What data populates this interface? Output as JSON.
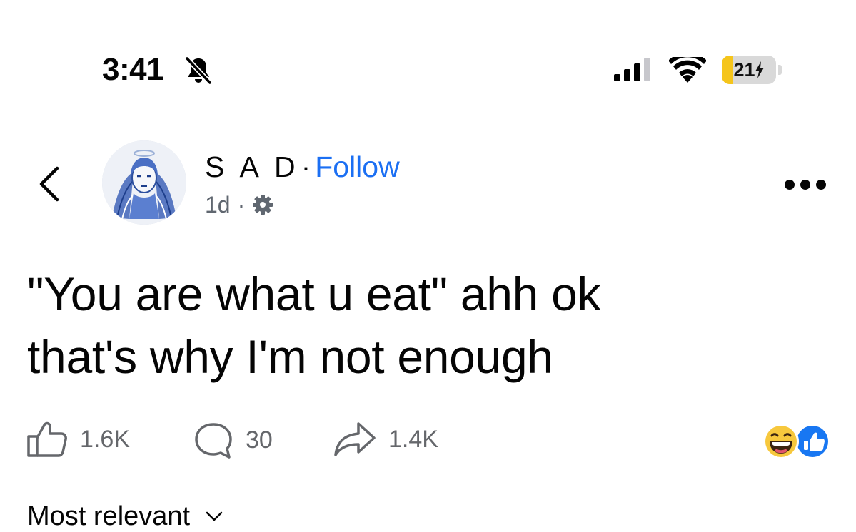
{
  "status_bar": {
    "time": "3:41",
    "icons": [
      "bell-slash-icon",
      "cellular-signal-icon",
      "wifi-icon",
      "battery-icon"
    ],
    "battery_percent": 21,
    "battery_label": "21",
    "battery_charging": true,
    "battery_color": "#f5c51b"
  },
  "header": {
    "back_icon": "chevron-left-icon",
    "author_name": "S A D",
    "separator": "·",
    "follow_label": "Follow",
    "follow_color": "#1b6ff3",
    "timestamp": "1d",
    "meta_separator": "·",
    "privacy_icon": "gear-icon",
    "more_icon": "more-horizontal-icon"
  },
  "post": {
    "lines": [
      "\"You are what u eat\" ahh ok",
      "that's why I'm not enough"
    ]
  },
  "actions": {
    "like_count": "1.6K",
    "comment_count": "30",
    "share_count": "1.4K",
    "reaction_icons": [
      "laughing-emoji-icon",
      "like-reaction-icon"
    ]
  },
  "comments": {
    "sort_label": "Most relevant"
  }
}
